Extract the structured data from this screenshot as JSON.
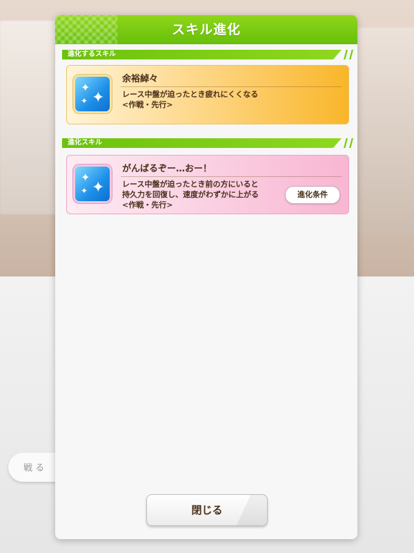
{
  "dialog": {
    "title": "スキル進化",
    "section_from": "進化するスキル",
    "section_to": "進化スキル",
    "close_label": "閉じる"
  },
  "skills": [
    {
      "name": "余裕綽々",
      "desc_line1": "レース中盤が迫ったとき疲れにくくなる",
      "desc_line2": "<作戦・先行>"
    },
    {
      "name": "がんばるぞー…おー！",
      "desc_line1": "レース中盤が迫ったとき前の方にいると",
      "desc_line2": "持久力を回復し、速度がわずかに上がる",
      "desc_line3": "<作戦・先行>",
      "condition_label": "進化条件"
    }
  ],
  "background": {
    "partial_button_label": "戦 る"
  },
  "colors": {
    "header_green": "#67bf0b",
    "card_orange": "#f9b62a",
    "card_pink": "#f8b6d2",
    "text_brown": "#4a2f1a"
  },
  "icons": [
    "sparkle-icon"
  ]
}
